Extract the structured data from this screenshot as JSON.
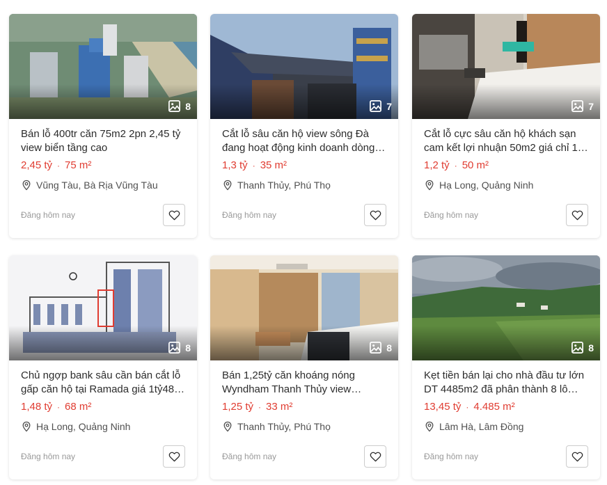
{
  "listings": [
    {
      "title": "Bán lỗ 400tr căn 75m2 2pn 2,45 tỷ view biển tầng cao",
      "price": "2,45 tỷ",
      "area": "75 m²",
      "location": "Vũng Tàu, Bà Rịa Vũng Tàu",
      "photos": "8",
      "posted": "Đăng hôm nay"
    },
    {
      "title": "Cắt lỗ sâu căn hộ view sông Đà đang hoạt động kinh doanh dòng…",
      "price": "1,3 tỷ",
      "area": "35 m²",
      "location": "Thanh Thủy, Phú Thọ",
      "photos": "7",
      "posted": "Đăng hôm nay"
    },
    {
      "title": "Cắt lỗ cực sâu căn hộ khách sạn cam kết lợi nhuận 50m2 giá chỉ 1…",
      "price": "1,2 tỷ",
      "area": "50 m²",
      "location": "Hạ Long, Quảng Ninh",
      "photos": "7",
      "posted": "Đăng hôm nay"
    },
    {
      "title": "Chủ ngợp bank sâu cần bán cắt lỗ gấp căn hộ tại Ramada giá 1tỷ48…",
      "price": "1,48 tỷ",
      "area": "68 m²",
      "location": "Hạ Long, Quảng Ninh",
      "photos": "8",
      "posted": "Đăng hôm nay"
    },
    {
      "title": "Bán 1,25tỷ căn khoáng nóng Wyndham Thanh Thủy view sông…",
      "price": "1,25 tỷ",
      "area": "33 m²",
      "location": "Thanh Thủy, Phú Thọ",
      "photos": "8",
      "posted": "Đăng hôm nay"
    },
    {
      "title": "Kẹt tiền bán lại cho nhà đầu tư lớn DT 4485m2 đã phân thành 8 lô m…",
      "price": "13,45 tỷ",
      "area": "4.485 m²",
      "location": "Lâm Hà, Lâm Đồng",
      "photos": "8",
      "posted": "Đăng hôm nay"
    }
  ],
  "icons": {
    "photo": "image-icon",
    "pin": "map-pin-icon",
    "heart": "heart-outline-icon"
  },
  "colors": {
    "price": "#e03c31",
    "title": "#2c2c2c",
    "muted": "#999999"
  }
}
